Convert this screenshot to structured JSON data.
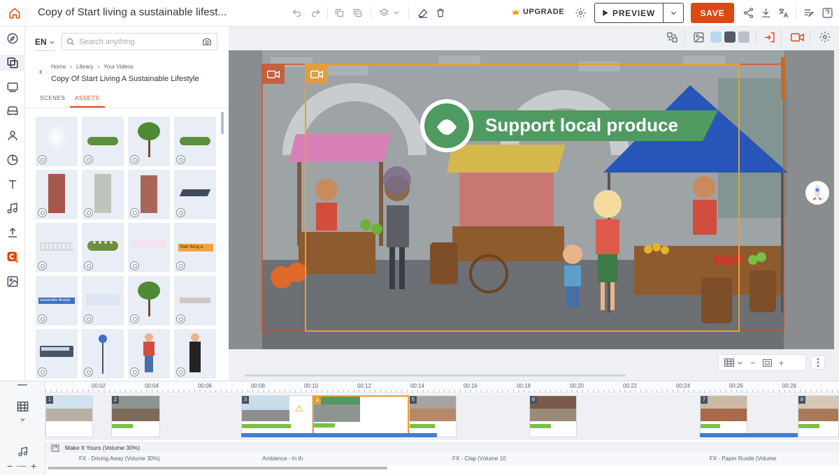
{
  "header": {
    "title": "Copy of Start living a sustainable lifest...",
    "upgrade_label": "UPGRADE",
    "preview_label": "PREVIEW",
    "save_label": "SAVE",
    "accent": "#dd4814"
  },
  "panel": {
    "language": "EN",
    "search_placeholder": "Search anything",
    "breadcrumb": [
      "Home",
      "Library",
      "Your Videos"
    ],
    "project_title": "Copy Of Start Living A Sustainable Lifestyle",
    "tabs": [
      "SCENES",
      "ASSETS"
    ],
    "active_tab": "ASSETS",
    "asset_texts": {
      "start_label": "Start living a",
      "sustainable_label": "sustainable lifestyle"
    }
  },
  "stage": {
    "scene_heading": "Support local produce"
  },
  "timeline": {
    "ticks": [
      "00:02",
      "00:04",
      "00:06",
      "00:08",
      "00:10",
      "00:12",
      "00:14",
      "00:16",
      "00:18",
      "00:20",
      "00:22",
      "00:24",
      "00:26",
      "00:28"
    ],
    "scene_numbers": [
      "1",
      "2",
      "3",
      "4",
      "5",
      "6",
      "7",
      "8"
    ],
    "music_label": "Make It Yours (Volume 30%)",
    "fx_labels": [
      "FX - Driving Away (Volume 30%)",
      "Ambience - In th",
      "FX - Clap (Volume 10",
      "FX - Paper Rustle (Volume"
    ]
  }
}
